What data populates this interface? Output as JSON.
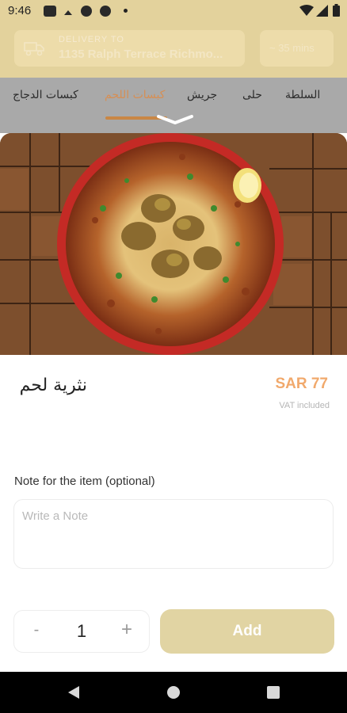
{
  "status_bar": {
    "time": "9:46"
  },
  "header": {
    "delivery_label": "DELIVERY TO",
    "delivery_address": "1135 Ralph Terrace Richmo...",
    "eta": "~ 35 mins"
  },
  "tabs": [
    {
      "label": "السلطة",
      "active": false
    },
    {
      "label": "حلى",
      "active": false
    },
    {
      "label": "جريش",
      "active": false
    },
    {
      "label": "كبسات اللحم",
      "active": true
    },
    {
      "label": "كبسات الدجاج",
      "active": false
    }
  ],
  "item": {
    "name": "نثرية لحم",
    "price": "SAR 77",
    "vat_note": "VAT included"
  },
  "note": {
    "label": "Note for the item (optional)",
    "placeholder": "Write a Note",
    "value": ""
  },
  "quantity": {
    "minus": "-",
    "value": "1",
    "plus": "+"
  },
  "add_button": {
    "label": "Add"
  },
  "colors": {
    "accent": "#f1a96c",
    "add_button_bg": "#e1d4a3",
    "header_bg": "#e3d29c",
    "active_tab": "#d68f55"
  },
  "icons": [
    "wifi-icon",
    "signal-icon",
    "battery-icon",
    "truck-icon",
    "chevron-down-icon",
    "back-icon",
    "home-icon",
    "recents-icon"
  ]
}
